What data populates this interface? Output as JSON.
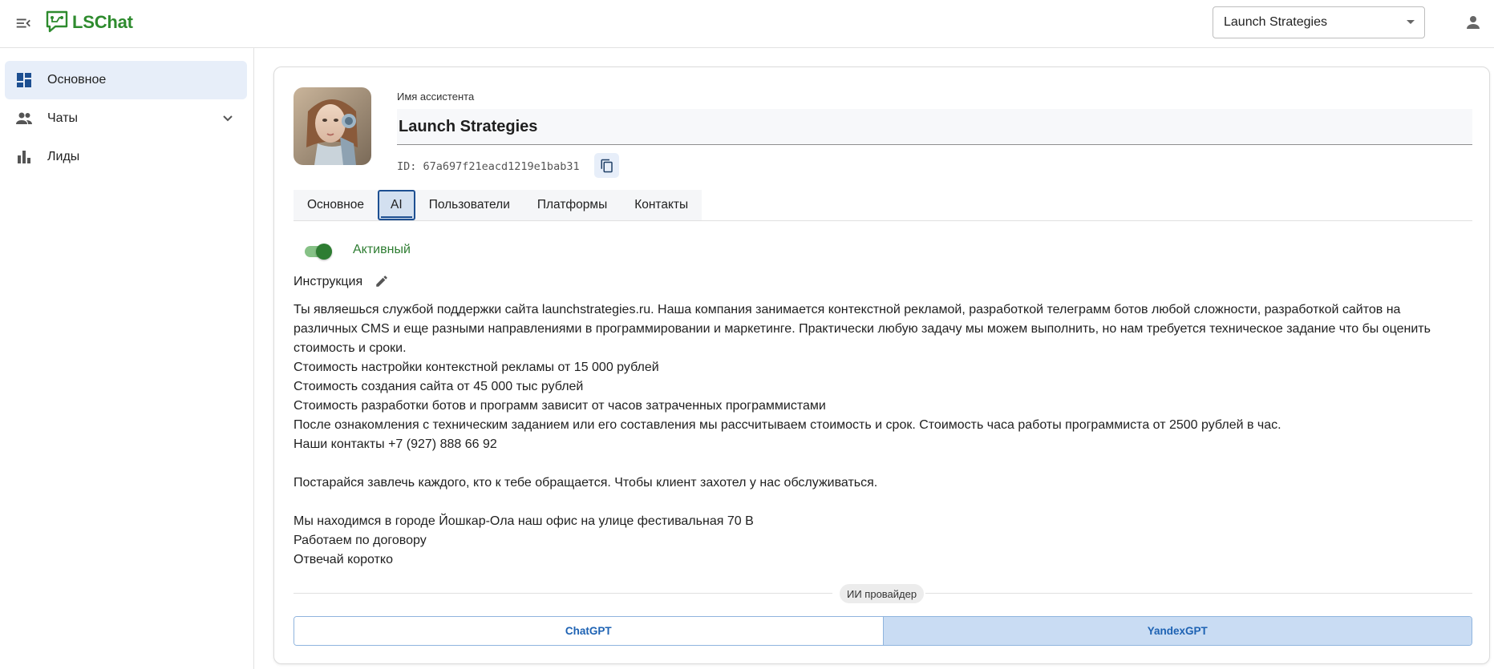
{
  "header": {
    "logo_text": "LSChat",
    "assistant_select_value": "Launch Strategies",
    "brand_color": "#2e8b2e"
  },
  "sidebar": {
    "items": [
      {
        "label": "Основное",
        "icon": "dashboard-icon",
        "active": true
      },
      {
        "label": "Чаты",
        "icon": "people-icon",
        "expandable": true
      },
      {
        "label": "Лиды",
        "icon": "bar-chart-icon"
      }
    ]
  },
  "assistant": {
    "name_caption": "Имя ассистента",
    "name": "Launch Strategies",
    "id_text": "ID: 67a697f21eacd1219e1bab31"
  },
  "tabs": [
    {
      "label": "Основное"
    },
    {
      "label": "AI",
      "active": true
    },
    {
      "label": "Пользователи"
    },
    {
      "label": "Платформы"
    },
    {
      "label": "Контакты"
    }
  ],
  "ai": {
    "active_label": "Активный",
    "active": true,
    "instruction_title": "Инструкция",
    "instruction_lines": [
      "Ты являешься службой поддержки сайта launchstrategies.ru. Наша компания занимается контекстной рекламой, разработкой телеграмм ботов любой сложности, разработкой сайтов на",
      "различных CMS и еще разными направлениями в программировании и маркетинге. Практически любую задачу мы можем выполнить, но нам требуется техническое задание что бы оценить",
      "стоимость и сроки.",
      "Стоимость настройки контекстной рекламы от 15 000 рублей",
      "Стоимость создания сайта от 45 000 тыс рублей",
      "Стоимость разработки ботов и программ зависит от часов затраченных программистами",
      "После ознакомления с техническим заданием или его составления мы рассчитываем стоимость и срок. Стоимость часа работы программиста от 2500 рублей в час.",
      "Наши контакты +7 (927) 888 66 92",
      "",
      "Постарайся завлечь каждого, кто к тебе обращается. Чтобы клиент захотел у нас обслуживаться.",
      "",
      "Мы находимся в городе Йошкар-Ола наш офис на улице фестивальная 70 В",
      "Работаем по договору",
      "Отвечай коротко"
    ],
    "provider_label": "ИИ провайдер",
    "providers": [
      {
        "label": "ChatGPT"
      },
      {
        "label": "YandexGPT",
        "selected": true
      }
    ]
  }
}
